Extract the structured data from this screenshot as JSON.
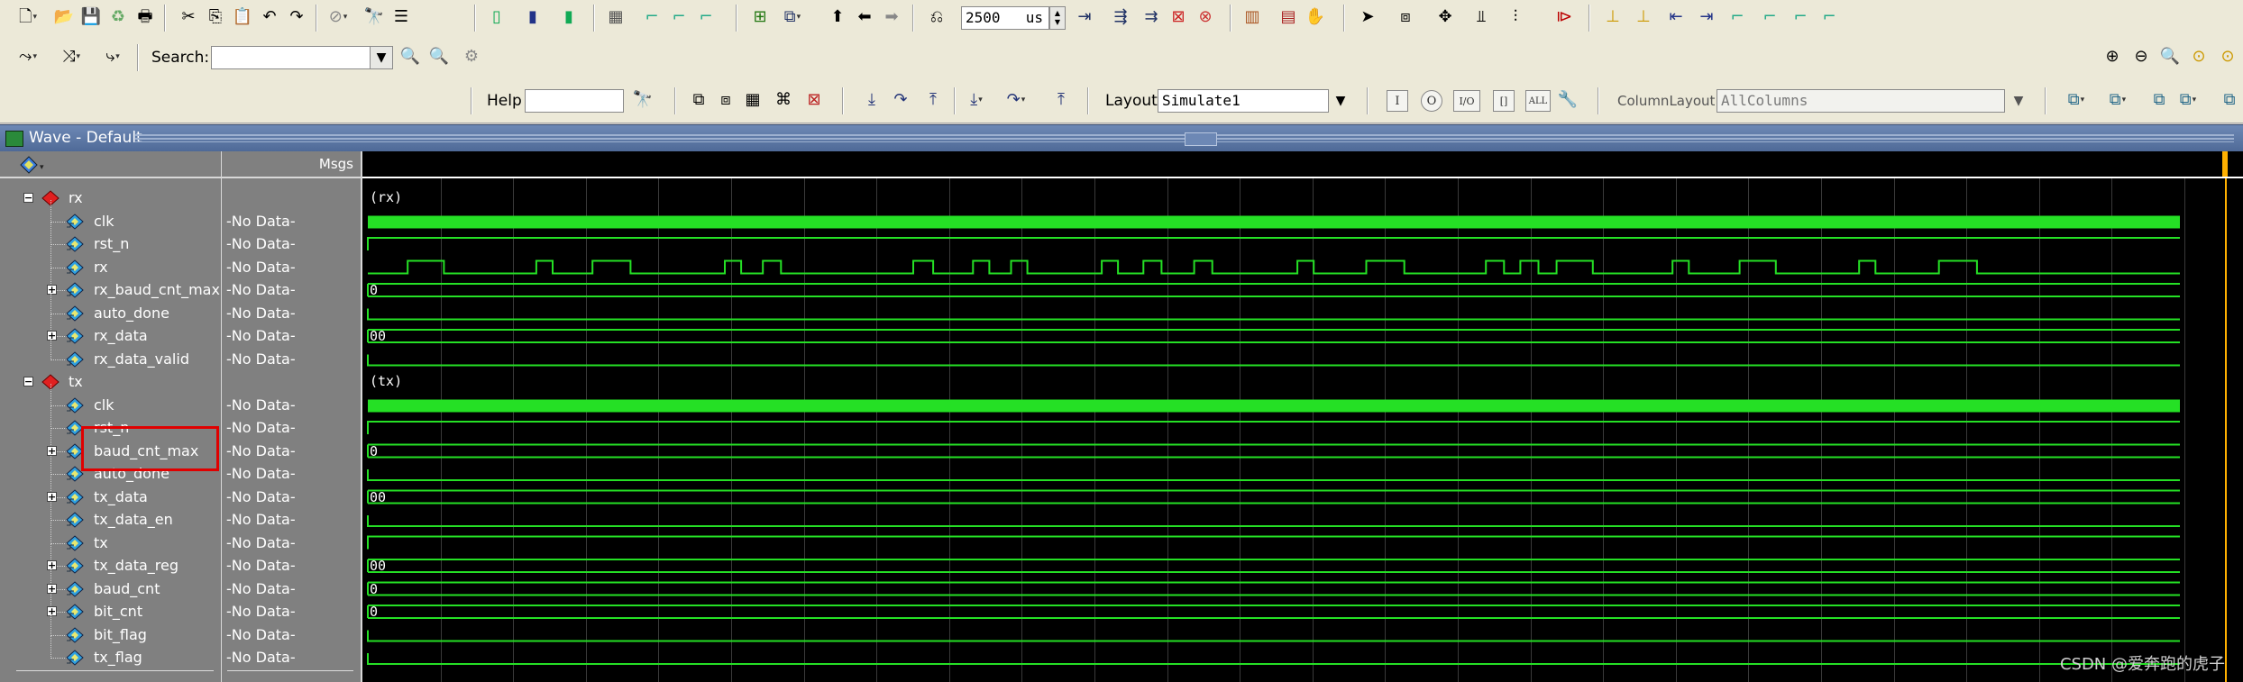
{
  "toolbar": {
    "time_value": "2500",
    "time_unit": "us",
    "search_label": "Search:",
    "search_value": "",
    "help_label": "Help",
    "help_value": "",
    "layout_label": "Layout",
    "layout_value": "Simulate1",
    "column_layout_label": "ColumnLayout",
    "column_layout_value": "AllColumns",
    "mode_buttons": [
      "I",
      "O",
      "I/O",
      "[]",
      "ALL"
    ]
  },
  "wave_window": {
    "title": "Wave - Default",
    "msgs_header": "Msgs"
  },
  "signals": [
    {
      "name": "rx",
      "type": "group",
      "msg": "",
      "expanded": true,
      "wave_label": "(rx)"
    },
    {
      "name": "clk",
      "type": "clock",
      "msg": "-No Data-",
      "wave_label": ""
    },
    {
      "name": "rst_n",
      "type": "bit-high",
      "msg": "-No Data-",
      "wave_label": ""
    },
    {
      "name": "rx",
      "type": "serial",
      "msg": "-No Data-",
      "wave_label": ""
    },
    {
      "name": "rx_baud_cnt_max",
      "type": "bus",
      "msg": "-No Data-",
      "wave_label": "0"
    },
    {
      "name": "auto_done",
      "type": "bit-low",
      "msg": "-No Data-",
      "wave_label": ""
    },
    {
      "name": "rx_data",
      "type": "bus",
      "msg": "-No Data-",
      "wave_label": "00"
    },
    {
      "name": "rx_data_valid",
      "type": "bit-low",
      "msg": "-No Data-",
      "wave_label": ""
    },
    {
      "name": "tx",
      "type": "group",
      "msg": "",
      "expanded": true,
      "wave_label": "(tx)"
    },
    {
      "name": "clk",
      "type": "clock",
      "msg": "-No Data-",
      "wave_label": ""
    },
    {
      "name": "rst_n",
      "type": "bit-high",
      "msg": "-No Data-",
      "wave_label": ""
    },
    {
      "name": "baud_cnt_max",
      "type": "bus",
      "msg": "-No Data-",
      "wave_label": "0"
    },
    {
      "name": "auto_done",
      "type": "bit-low",
      "msg": "-No Data-",
      "wave_label": ""
    },
    {
      "name": "tx_data",
      "type": "bus",
      "msg": "-No Data-",
      "wave_label": "00"
    },
    {
      "name": "tx_data_en",
      "type": "bit-low",
      "msg": "-No Data-",
      "wave_label": ""
    },
    {
      "name": "tx",
      "type": "bit-high",
      "msg": "-No Data-",
      "wave_label": ""
    },
    {
      "name": "tx_data_reg",
      "type": "bus",
      "msg": "-No Data-",
      "wave_label": "00"
    },
    {
      "name": "baud_cnt",
      "type": "bus",
      "msg": "-No Data-",
      "wave_label": "0"
    },
    {
      "name": "bit_cnt",
      "type": "bus",
      "msg": "-No Data-",
      "wave_label": "0"
    },
    {
      "name": "bit_flag",
      "type": "bit-low",
      "msg": "-No Data-",
      "wave_label": ""
    },
    {
      "name": "tx_flag",
      "type": "bit-low",
      "msg": "-No Data-",
      "wave_label": ""
    }
  ],
  "rx_serial_transitions_fraction": [
    0.022,
    0.042,
    0.093,
    0.102,
    0.124,
    0.145,
    0.197,
    0.206,
    0.218,
    0.228,
    0.301,
    0.312,
    0.334,
    0.343,
    0.355,
    0.364,
    0.405,
    0.414,
    0.428,
    0.438,
    0.456,
    0.466,
    0.513,
    0.522,
    0.551,
    0.572,
    0.617,
    0.627,
    0.636,
    0.646,
    0.656,
    0.676,
    0.72,
    0.729,
    0.757,
    0.777,
    0.823,
    0.832,
    0.867,
    0.888
  ],
  "colors": {
    "wave_green": "#25e025",
    "selection_red": "#e00000",
    "cursor_orange": "#ffb000",
    "title_blue": "#5b77a6"
  },
  "watermark": "CSDN @爱奔跑的虎子"
}
